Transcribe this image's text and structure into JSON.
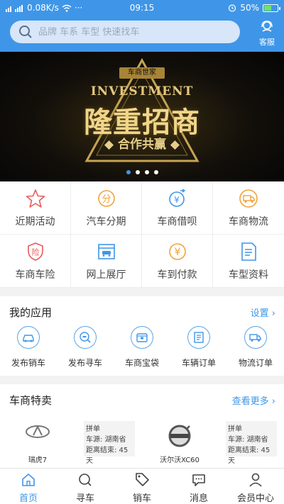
{
  "status_bar": {
    "network_speed": "0.08K/s",
    "time": "09:15",
    "battery": "50%"
  },
  "header": {
    "search_placeholder": "品牌 车系 车型 快速找车",
    "service_label": "客服"
  },
  "banner": {
    "badge": "车商世家",
    "headline_en": "INVESTMENT",
    "headline_cn": "隆重招商",
    "subtitle": "◆ 合作共赢 ◆",
    "slide_count": 4,
    "active_slide": 1
  },
  "services": [
    {
      "label": "近期活动",
      "icon": "star-icon",
      "color": "#e85a5a"
    },
    {
      "label": "汽车分期",
      "icon": "installment-icon",
      "color": "#f1a33a"
    },
    {
      "label": "车商借呗",
      "icon": "yuan-exchange-icon",
      "color": "#3f96e8"
    },
    {
      "label": "车商物流",
      "icon": "logistics-icon",
      "color": "#f1a33a"
    },
    {
      "label": "车商车险",
      "icon": "insurance-shield-icon",
      "color": "#e85a5a"
    },
    {
      "label": "网上展厅",
      "icon": "showroom-icon",
      "color": "#3f96e8"
    },
    {
      "label": "车到付款",
      "icon": "yuan-coin-icon",
      "color": "#f1a33a"
    },
    {
      "label": "车型资料",
      "icon": "document-icon",
      "color": "#3f96e8"
    }
  ],
  "my_apps": {
    "title": "我的应用",
    "more": "设置 ›",
    "items": [
      {
        "label": "发布销车",
        "icon": "car-sell-icon"
      },
      {
        "label": "发布寻车",
        "icon": "car-search-icon"
      },
      {
        "label": "车商宝袋",
        "icon": "wallet-icon"
      },
      {
        "label": "车辆订单",
        "icon": "order-icon"
      },
      {
        "label": "物流订单",
        "icon": "truck-icon"
      }
    ]
  },
  "dealer_sale": {
    "title": "车商特卖",
    "more": "查看更多 ›",
    "items": [
      {
        "name": "瑞虎7",
        "tag": "拼单",
        "source": "车源: 湖南省",
        "countdown": "距离结束: 45天",
        "logo": "chery-logo"
      },
      {
        "name": "沃尔沃XC60",
        "tag": "拼单",
        "source": "车源: 湖南省",
        "countdown": "距离结束: 45天",
        "logo": "volvo-logo"
      }
    ]
  },
  "bottom_nav": [
    {
      "label": "首页",
      "icon": "home-icon",
      "active": true
    },
    {
      "label": "寻车",
      "icon": "search-icon",
      "active": false
    },
    {
      "label": "销车",
      "icon": "sell-tag-icon",
      "active": false
    },
    {
      "label": "消息",
      "icon": "message-icon",
      "active": false
    },
    {
      "label": "会员中心",
      "icon": "user-icon",
      "active": false
    }
  ],
  "colors": {
    "primary": "#3f96e8",
    "accent_orange": "#f1a33a",
    "accent_red": "#e85a5a"
  }
}
